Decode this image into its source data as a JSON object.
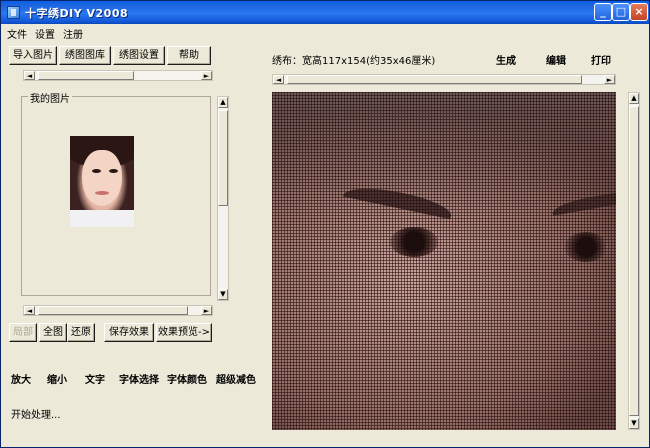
{
  "window": {
    "title": "十字绣DIY V2008"
  },
  "title_buttons": {
    "minimize": "_",
    "maximize": "□",
    "close": "×"
  },
  "menu": [
    "文件",
    "设置",
    "注册"
  ],
  "toolbar_left": [
    "导入图片",
    "绣图图库",
    "绣图设置",
    "帮助"
  ],
  "image_group": {
    "title": "我的图片"
  },
  "left_buttons": {
    "local": "局部",
    "full": "全图",
    "restore": "还原",
    "save_effect": "保存效果",
    "preview": "效果预览->"
  },
  "text_tools": [
    "放大",
    "缩小",
    "文字",
    "字体选择",
    "字体颜色",
    "超级减色"
  ],
  "status": "开始处理...",
  "right_header": {
    "info": "绣布：宽高117x154(约35x46厘米)",
    "generate": "生成",
    "edit": "编辑",
    "print": "打印"
  },
  "scroll": {
    "left_arrow": "◄",
    "right_arrow": "►",
    "up_arrow": "▲",
    "down_arrow": "▼"
  }
}
